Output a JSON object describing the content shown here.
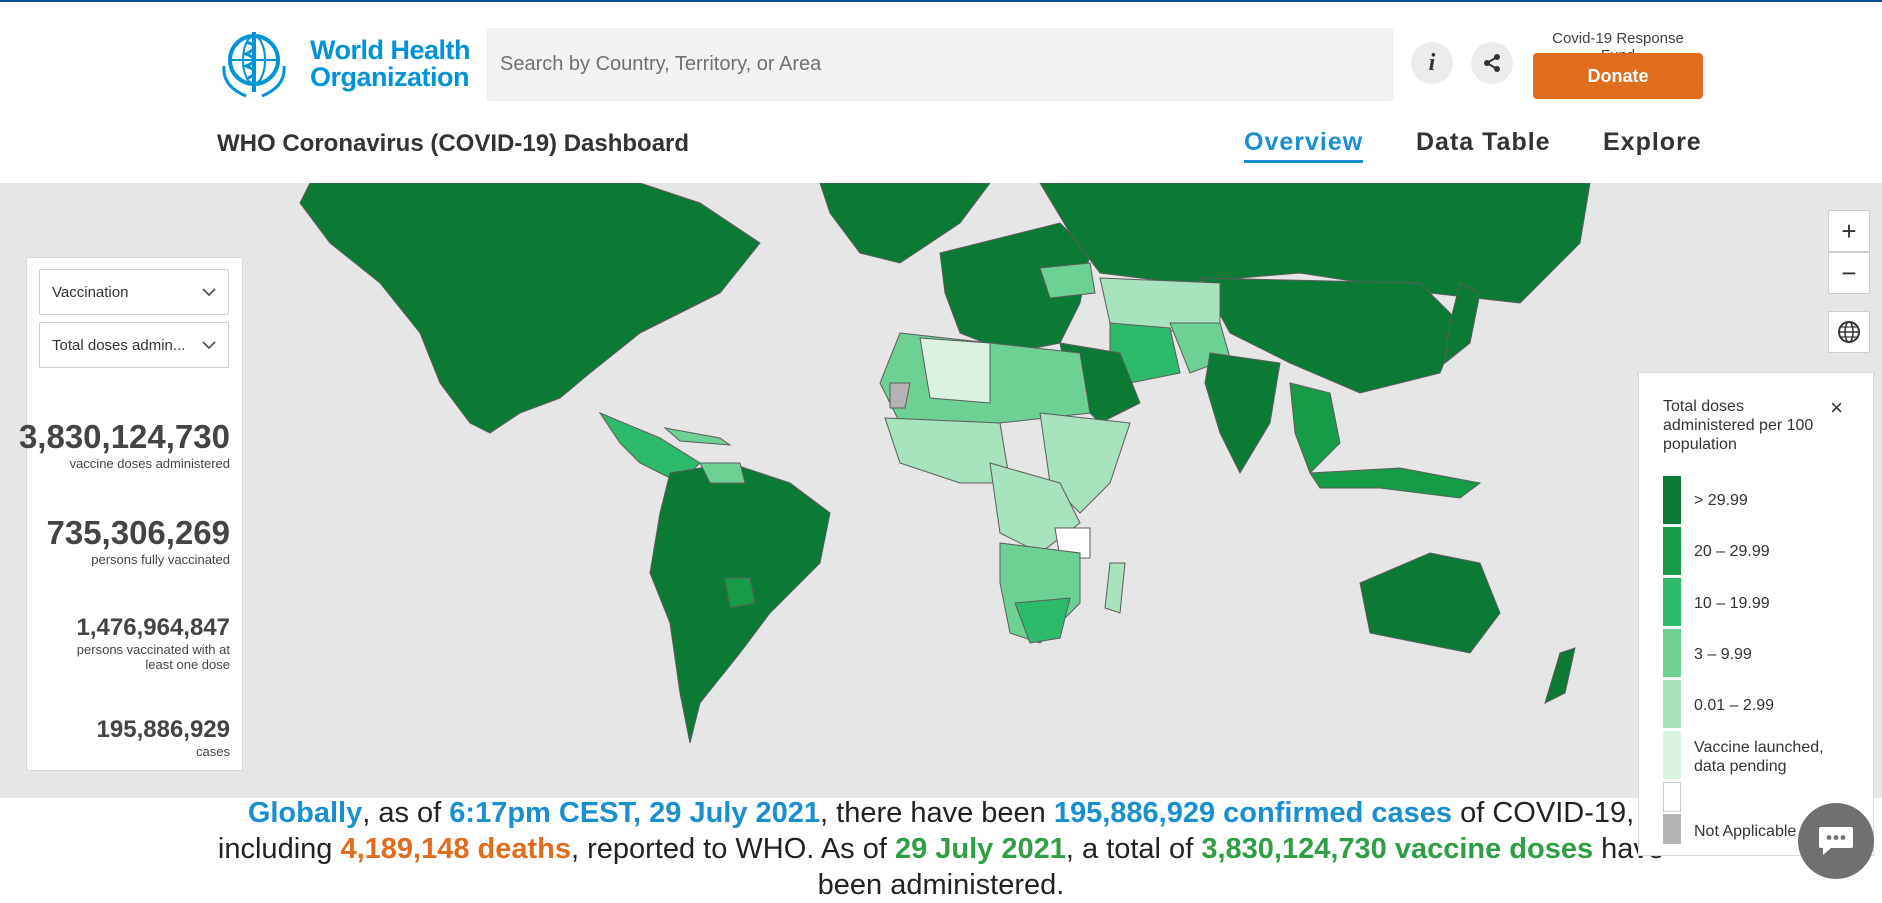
{
  "header": {
    "logo_text_line1": "World Health",
    "logo_text_line2": "Organization",
    "search_placeholder": "Search by Country, Territory, or Area",
    "fund_label": "Covid-19 Response Fund",
    "donate_label": "Donate",
    "dashboard_title": "WHO Coronavirus (COVID-19) Dashboard",
    "nav": [
      {
        "label": "Overview",
        "active": true
      },
      {
        "label": "Data Table",
        "active": false
      },
      {
        "label": "Explore",
        "active": false
      }
    ]
  },
  "sidebar": {
    "dropdown_1": "Vaccination",
    "dropdown_2": "Total doses admin...",
    "stats": [
      {
        "value": "3,830,124,730",
        "label": "vaccine doses administered"
      },
      {
        "value": "735,306,269",
        "label": "persons fully vaccinated"
      },
      {
        "value": "1,476,964,847",
        "label_line1": "persons vaccinated with at",
        "label_line2": "least one dose"
      },
      {
        "value": "195,886,929",
        "label": "cases"
      }
    ]
  },
  "map_controls": {
    "zoom_in": "+",
    "zoom_out": "−"
  },
  "legend": {
    "title": "Total doses administered per 100 population",
    "close": "×",
    "items": [
      {
        "label": "> 29.99",
        "color": "#0b7a35"
      },
      {
        "label": "20 – 29.99",
        "color": "#169c47"
      },
      {
        "label": "10 – 19.99",
        "color": "#2dbb6b"
      },
      {
        "label": "3 – 9.99",
        "color": "#6dd193"
      },
      {
        "label": "0.01 – 2.99",
        "color": "#a7e3bd"
      },
      {
        "label_line1": "Vaccine launched,",
        "label_line2": "data pending",
        "color": "#d9f2e1"
      },
      {
        "label": "",
        "color": "#ffffff"
      },
      {
        "label": "Not Applicable",
        "color": "#b3b3b3"
      }
    ]
  },
  "summary": {
    "globally": "Globally",
    "t1": ", as of ",
    "datetime": "6:17pm CEST, 29 July 2021",
    "t2": ", there have been ",
    "cases": "195,886,929 confirmed cases",
    "t3": " of COVID-19,",
    "t4": "including ",
    "deaths": "4,189,148 deaths",
    "t5": ", reported to WHO. As of ",
    "vax_date": "29 July 2021",
    "t6": ", a total of ",
    "doses": "3,830,124,730 vaccine doses",
    "t7": " have",
    "t8": "been administered."
  },
  "colors": {
    "brand_blue": "#0093d5",
    "accent_orange": "#e06c1e",
    "map_dark_green": "#0b7a35"
  }
}
